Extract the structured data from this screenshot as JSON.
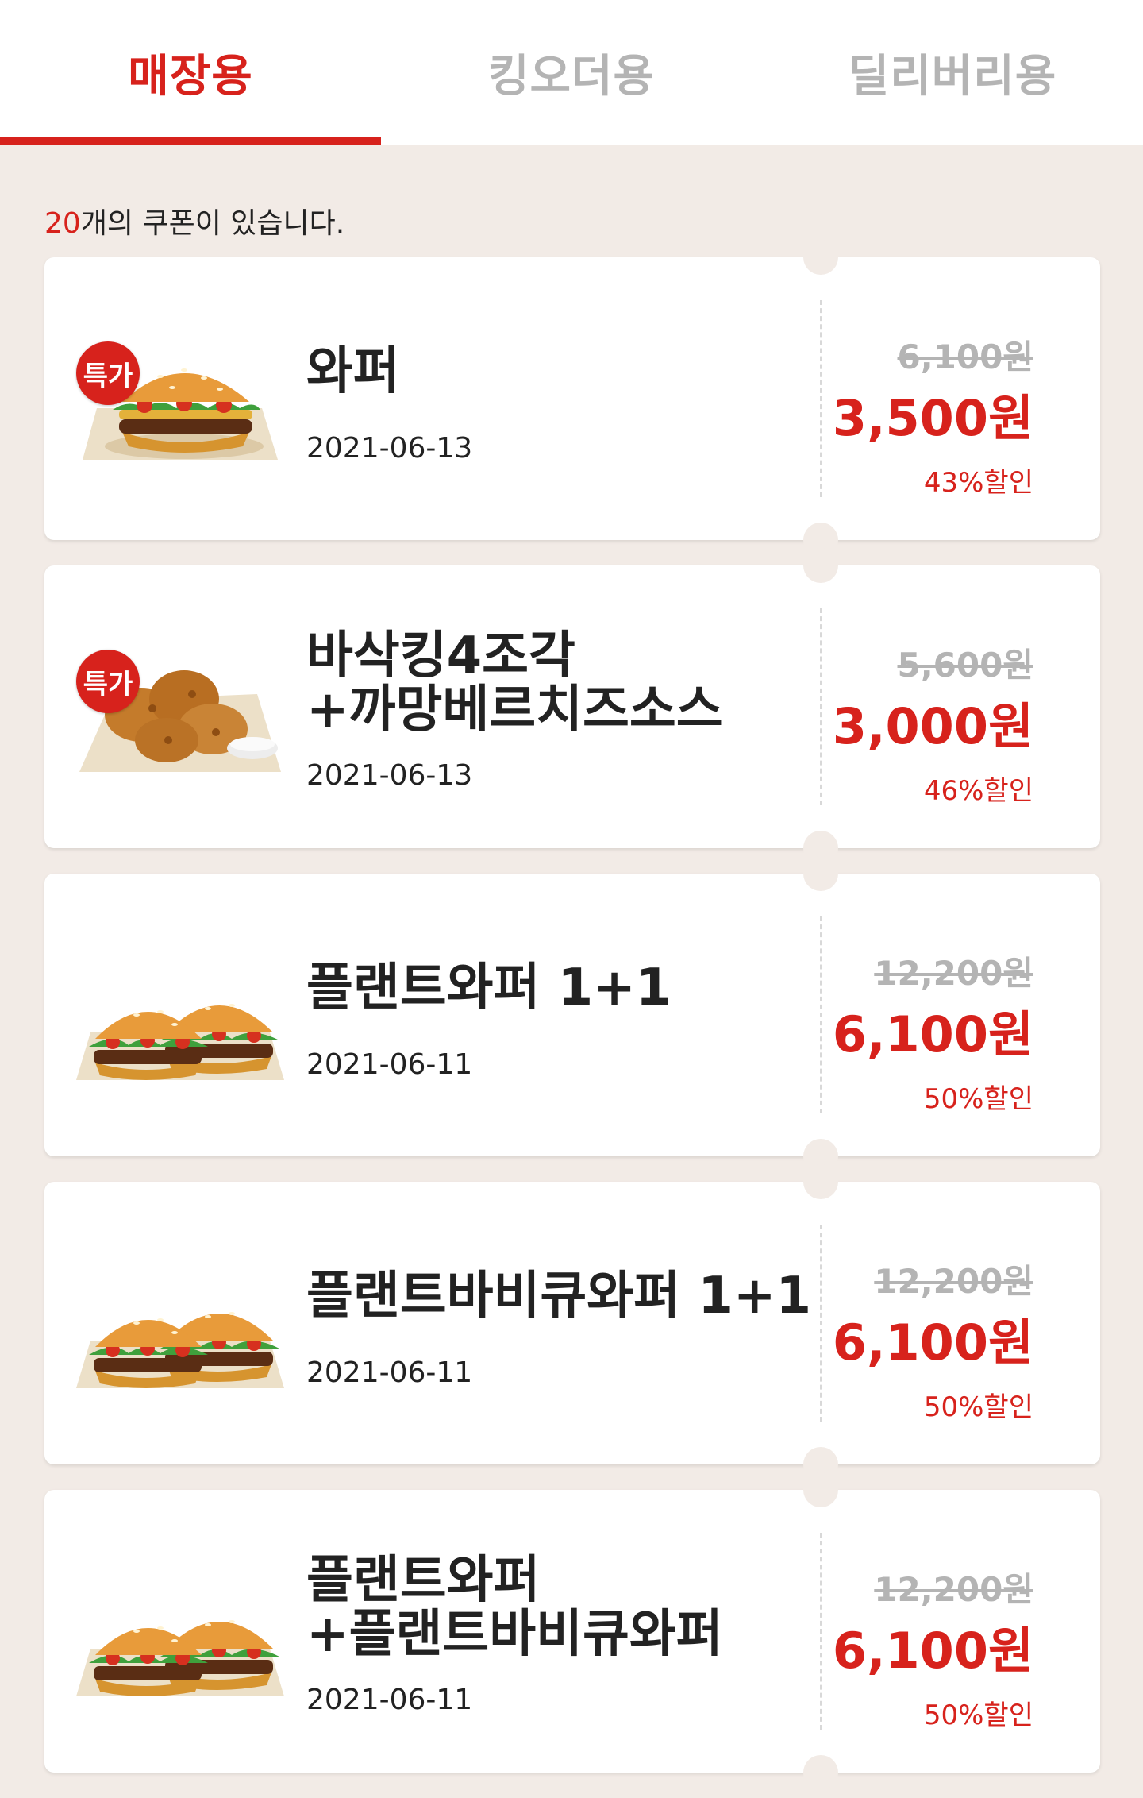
{
  "tabs": [
    {
      "label": "매장용",
      "active": true
    },
    {
      "label": "킹오더용",
      "active": false
    },
    {
      "label": "딜리버리용",
      "active": false
    }
  ],
  "summary": {
    "count": "20",
    "text": "개의 쿠폰이 있습니다."
  },
  "colors": {
    "accent": "#d7221c",
    "inactive_tab": "#b4b4b4",
    "background": "#f2ebe6"
  },
  "badge_label": "특가",
  "coupons": [
    {
      "name": "와퍼",
      "date": "2021-06-13",
      "original_price": "6,100원",
      "price": "3,500원",
      "discount": "43%할인",
      "badge": true,
      "image": "whopper-image"
    },
    {
      "name": "바삭킹4조각\n+까망베르치즈소스",
      "date": "2021-06-13",
      "original_price": "5,600원",
      "price": "3,000원",
      "discount": "46%할인",
      "badge": true,
      "image": "chicken-image"
    },
    {
      "name": "플랜트와퍼 1+1",
      "date": "2021-06-11",
      "original_price": "12,200원",
      "price": "6,100원",
      "discount": "50%할인",
      "badge": false,
      "image": "double-burger-image"
    },
    {
      "name": "플랜트바비큐와퍼 1+1",
      "date": "2021-06-11",
      "original_price": "12,200원",
      "price": "6,100원",
      "discount": "50%할인",
      "badge": false,
      "image": "double-burger-image"
    },
    {
      "name": "플랜트와퍼\n+플랜트바비큐와퍼",
      "date": "2021-06-11",
      "original_price": "12,200원",
      "price": "6,100원",
      "discount": "50%할인",
      "badge": false,
      "image": "double-burger-image"
    }
  ]
}
